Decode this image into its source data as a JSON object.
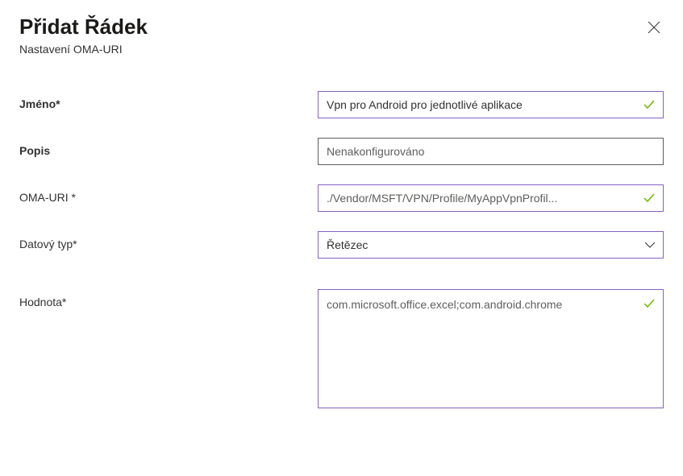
{
  "header": {
    "title": "Přidat Řádek",
    "subtitle": "Nastavení OMA-URI"
  },
  "form": {
    "name": {
      "label": "Jméno*",
      "value": "Vpn pro Android pro jednotlivé aplikace"
    },
    "description": {
      "label": "Popis",
      "placeholder": "Nenakonfigurováno"
    },
    "omauri": {
      "label": "OMA-URI *",
      "value": "./Vendor/MSFT/VPN/Profile/MyAppVpnProfil..."
    },
    "datatype": {
      "label": "Datový typ*",
      "value": "Řetězec"
    },
    "value": {
      "label": "Hodnota*",
      "value": "com.microsoft.office.excel;com.android.chrome"
    }
  },
  "icons": {
    "check": "check-icon",
    "chevron": "chevron-down-icon",
    "close": "close-icon"
  },
  "colors": {
    "accent": "#8661c5",
    "success": "#6bb700",
    "border": "#605e5c",
    "text": "#323130"
  }
}
